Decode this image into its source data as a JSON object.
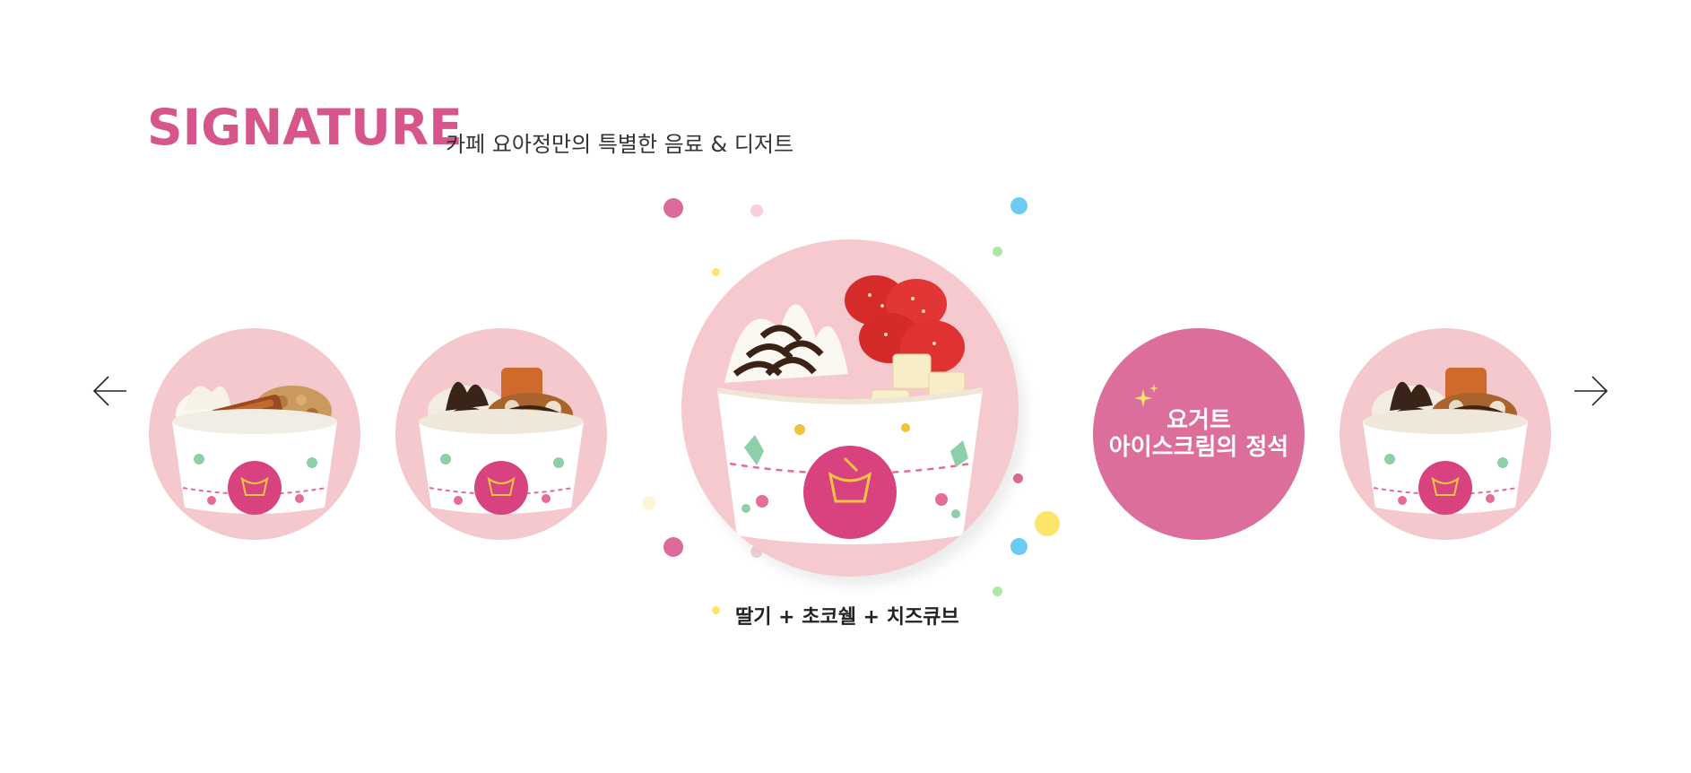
{
  "header": {
    "title": "SIGNATURE",
    "subtitle": "카페 요아정만의 특별한 음료 & 디저트"
  },
  "carousel": {
    "prev_icon": "arrow-left-icon",
    "next_icon": "arrow-right-icon",
    "cup_label_top": "요거트 아이스크림의 정석",
    "cup_brand": "YOAJUNG",
    "active_caption": "딸기 + 초코쉘 + 치즈큐브",
    "promo": {
      "line1": "요거트",
      "line2": "아이스크림의 정석"
    }
  },
  "colors": {
    "brand_pink": "#d6568b",
    "circle_pink": "#f4c8cc",
    "promo_pink": "#dc6e9c",
    "dot_blue": "#6ccbf2",
    "dot_green": "#a9e9a0",
    "dot_yellow": "#fde46a"
  }
}
